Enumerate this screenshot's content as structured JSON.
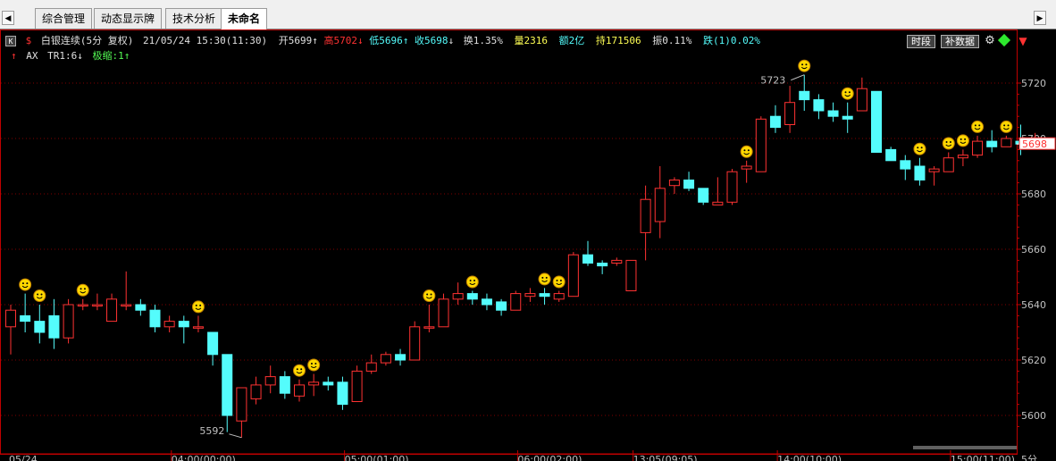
{
  "tabs": [
    "综合管理",
    "动态显示牌",
    "技术分析",
    "未命名"
  ],
  "nav": {
    "left": "◀",
    "right": "▶"
  },
  "header": {
    "symbol_icon": "K",
    "dollar": "$",
    "name": "白银连续(5分 复权)",
    "datetime": "21/05/24 15:30(11:30)",
    "open_label": "开5699",
    "high_label": "高5702",
    "low_label": "低5696",
    "close_label": "收5698",
    "turnover_label": "换1.35%",
    "volume_label": "量2316",
    "amount_label": "额2亿",
    "hold_label": "持171506",
    "amp_label": "振0.11%",
    "fall_label": "跌(1)0.02%",
    "arrow_up": "↑",
    "arrow_down": "↓"
  },
  "indicator": {
    "arrow": "↑",
    "name": "AX",
    "tr": "TR1:6",
    "tr_arrow": "↓",
    "jisuo": "极缩:1",
    "jisuo_arrow": "↑"
  },
  "buttons": {
    "timeframe": "时段",
    "supplement": "补数据"
  },
  "icons": {
    "settings": "gear-icon",
    "diamond": "diamond-icon",
    "smiley": "smiley-face-icon"
  },
  "colors": {
    "up": "#ff3232",
    "down": "#54fcfc",
    "grid": "#800000",
    "axis": "#c00000",
    "text": "#c0c0c0"
  },
  "chart_data": {
    "type": "candlestick",
    "y_ticks": [
      5600,
      5620,
      5640,
      5660,
      5680,
      5700,
      5720
    ],
    "ylim": [
      5592,
      5724
    ],
    "last_price": 5698,
    "annotations": [
      {
        "label": "5723",
        "value": 5723
      },
      {
        "label": "5592",
        "value": 5592
      }
    ],
    "x_labels": [
      "05/24",
      "04:00(00:00)",
      "05:00(01:00)",
      "06:00(02:00)",
      "13:05(09:05)",
      "14:00(10:00)",
      "15:00(11:00)",
      "5分"
    ],
    "x_label_index": [
      0,
      12,
      24,
      36,
      44,
      54,
      66,
      71
    ],
    "candles": [
      [
        5632,
        5638,
        5622,
        5640
      ],
      [
        5636,
        5634,
        5630,
        5644
      ],
      [
        5634,
        5630,
        5626,
        5640
      ],
      [
        5636,
        5628,
        5624,
        5642
      ],
      [
        5628,
        5640,
        5626,
        5642
      ],
      [
        5640,
        5640,
        5638,
        5642
      ],
      [
        5640,
        5640,
        5638,
        5644
      ],
      [
        5634,
        5642,
        5634,
        5644
      ],
      [
        5640,
        5640,
        5638,
        5652
      ],
      [
        5640,
        5638,
        5636,
        5642
      ],
      [
        5638,
        5632,
        5630,
        5640
      ],
      [
        5632,
        5634,
        5630,
        5636
      ],
      [
        5634,
        5632,
        5626,
        5636
      ],
      [
        5632,
        5632,
        5630,
        5636
      ],
      [
        5630,
        5622,
        5618,
        5630
      ],
      [
        5622,
        5600,
        5594,
        5622
      ],
      [
        5598,
        5610,
        5592,
        5610
      ],
      [
        5606,
        5611,
        5604,
        5614
      ],
      [
        5611,
        5614,
        5608,
        5618
      ],
      [
        5614,
        5608,
        5606,
        5616
      ],
      [
        5607,
        5611,
        5605,
        5613
      ],
      [
        5611,
        5612,
        5607,
        5615
      ],
      [
        5612,
        5611,
        5609,
        5614
      ],
      [
        5612,
        5604,
        5602,
        5614
      ],
      [
        5605,
        5616,
        5605,
        5618
      ],
      [
        5616,
        5619,
        5615,
        5622
      ],
      [
        5619,
        5622,
        5618,
        5623
      ],
      [
        5622,
        5620,
        5618,
        5624
      ],
      [
        5620,
        5632,
        5620,
        5634
      ],
      [
        5632,
        5632,
        5630,
        5640
      ],
      [
        5632,
        5642,
        5632,
        5644
      ],
      [
        5642,
        5644,
        5640,
        5648
      ],
      [
        5644,
        5642,
        5640,
        5645
      ],
      [
        5642,
        5640,
        5638,
        5644
      ],
      [
        5641,
        5638,
        5636,
        5642
      ],
      [
        5638,
        5644,
        5638,
        5645
      ],
      [
        5643,
        5644,
        5641,
        5646
      ],
      [
        5644,
        5643,
        5640,
        5646
      ],
      [
        5642,
        5644,
        5641,
        5645
      ],
      [
        5643,
        5658,
        5643,
        5659
      ],
      [
        5658,
        5655,
        5654,
        5663
      ],
      [
        5655,
        5654,
        5651,
        5656
      ],
      [
        5655,
        5656,
        5654,
        5657
      ],
      [
        5645,
        5656,
        5645,
        5656
      ],
      [
        5666,
        5678,
        5656,
        5683
      ],
      [
        5670,
        5682,
        5664,
        5690
      ],
      [
        5683,
        5685,
        5680,
        5686
      ],
      [
        5685,
        5682,
        5681,
        5688
      ],
      [
        5682,
        5677,
        5676,
        5682
      ],
      [
        5676,
        5677,
        5676,
        5686
      ],
      [
        5677,
        5688,
        5676,
        5689
      ],
      [
        5689,
        5690,
        5684,
        5692
      ],
      [
        5688,
        5707,
        5688,
        5708
      ],
      [
        5708,
        5704,
        5702,
        5712
      ],
      [
        5705,
        5713,
        5702,
        5719
      ],
      [
        5717,
        5714,
        5710,
        5723
      ],
      [
        5714,
        5710,
        5707,
        5716
      ],
      [
        5710,
        5708,
        5706,
        5713
      ],
      [
        5708,
        5707,
        5702,
        5713
      ],
      [
        5710,
        5718,
        5710,
        5722
      ],
      [
        5717,
        5695,
        5695,
        5717
      ],
      [
        5696,
        5692,
        5692,
        5697
      ],
      [
        5692,
        5689,
        5685,
        5694
      ],
      [
        5690,
        5685,
        5683,
        5693
      ],
      [
        5688,
        5689,
        5683,
        5690
      ],
      [
        5688,
        5693,
        5688,
        5695
      ],
      [
        5693,
        5694,
        5690,
        5696
      ],
      [
        5694,
        5699,
        5693,
        5701
      ],
      [
        5699,
        5697,
        5695,
        5703
      ],
      [
        5697,
        5700,
        5697,
        5701
      ],
      [
        5699,
        5698,
        5694,
        5705
      ],
      [
        5698,
        5699,
        5696,
        5702
      ]
    ],
    "smiley_index": [
      1,
      2,
      5,
      13,
      20,
      21,
      29,
      32,
      37,
      38,
      51,
      55,
      58,
      63,
      65,
      66,
      67,
      69
    ]
  }
}
